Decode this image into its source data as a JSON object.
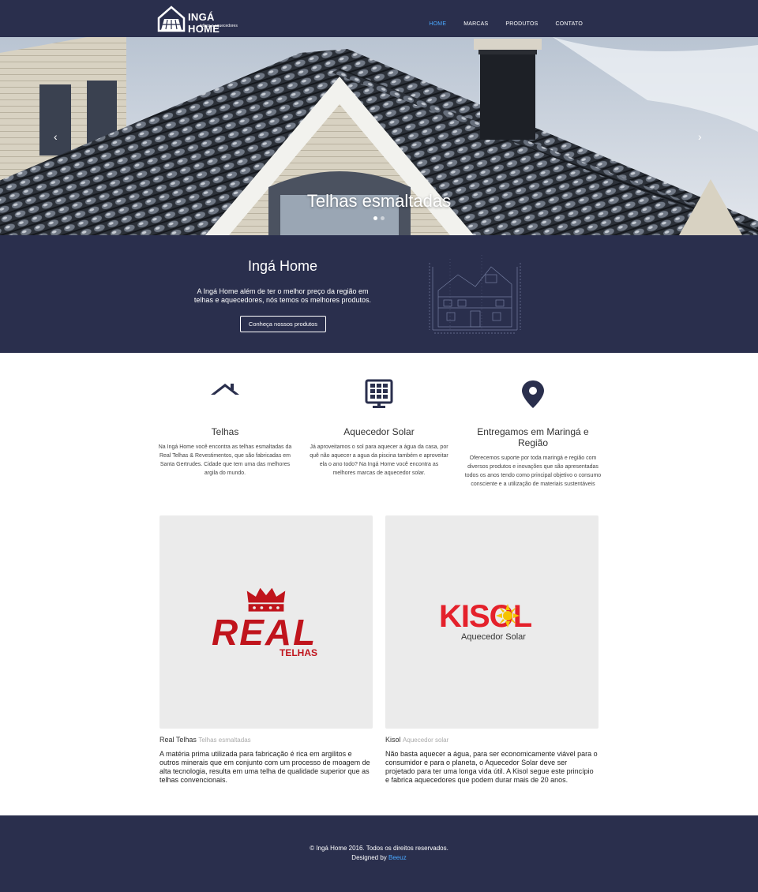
{
  "brand": {
    "name": "INGÁ HOME",
    "tagline": "telhas e aquecedores"
  },
  "nav": {
    "items": [
      {
        "label": "HOME",
        "active": true
      },
      {
        "label": "MARCAS",
        "active": false
      },
      {
        "label": "PRODUTOS",
        "active": false
      },
      {
        "label": "CONTATO",
        "active": false
      }
    ]
  },
  "hero": {
    "caption": "Telhas esmaltadas",
    "prev_icon": "chevron-left-icon",
    "next_icon": "chevron-right-icon",
    "slides_count": 2,
    "active_slide": 1
  },
  "about": {
    "title": "Ingá Home",
    "text": "A Ingá Home além de ter o melhor preço da região em telhas e aquecedores, nós temos os melhores produtos.",
    "button": "Conheça nossos produtos"
  },
  "features": [
    {
      "icon": "roof-icon",
      "title": "Telhas",
      "text": "Na Ingá Home você encontra as telhas esmaltadas da Real Telhas & Revestimentos, que são fabricadas em Santa Gertrudes. Cidade que tem uma das melhores argila do mundo."
    },
    {
      "icon": "solar-panel-icon",
      "title": "Aquecedor Solar",
      "text": "Já aproveitamos o sol para aquecer a água da casa, por quê não aquecer a agua da piscina também e aproveitar ela o ano todo? Na Ingá Home você encontra as melhores marcas de aquecedor solar."
    },
    {
      "icon": "map-pin-icon",
      "title": "Entregamos em Maringá e Região",
      "text": "Oferecemos suporte por toda maringá e região com diversos produtos e inovações que são apresentadas todos os anos tendo como principal objetivo o consumo consciente e a utilização de materiais sustentáveis"
    }
  ],
  "brands": [
    {
      "logo_main": "REAL",
      "logo_sub": "TELHAS",
      "name": "Real Telhas",
      "category": "Telhas esmaltadas",
      "text": "A matéria prima utilizada para fabricação é rica em argilitos e outros minerais que em conjunto com um processo de moagem de alta tecnologia, resulta em uma telha de qualidade superior que as telhas convencionais.",
      "color": "#c0141c"
    },
    {
      "logo_main": "KISOL",
      "logo_sub": "Aquecedor Solar",
      "name": "Kisol",
      "category": "Aquecedor solar",
      "text": "Não basta aquecer a água, para ser economicamente viável para o consumidor e para o planeta, o Aquecedor Solar deve ser projetado para ter uma longa vida útil. A Kisol segue este princípio e fabrica aquecedores que podem durar mais de 20 anos.",
      "color": "#e4212b"
    }
  ],
  "footer": {
    "copyright": "© Ingá Home 2016. Todos os direitos reservados.",
    "designed_by_label": "Designed by",
    "designer": "Beeuz"
  },
  "colors": {
    "navy": "#2a2f4d",
    "accent": "#4aa8ff",
    "card_bg": "#ebebeb"
  }
}
